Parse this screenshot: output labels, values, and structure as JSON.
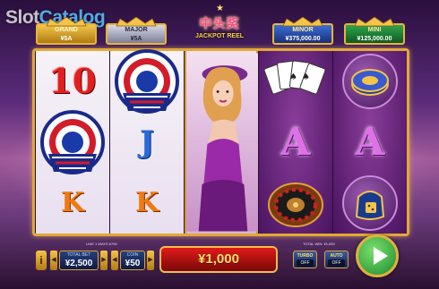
{
  "watermark": {
    "slot": "Slot",
    "catalog": "Catalog"
  },
  "jackpots": {
    "grand": {
      "name": "GRAND",
      "value": "¥5A"
    },
    "major": {
      "name": "MAJOR",
      "value": "¥5A"
    },
    "minor": {
      "name": "MINOR",
      "value": "¥375,000.00"
    },
    "mini": {
      "name": "MINI",
      "value": "¥125,000.00"
    }
  },
  "logo": {
    "cn": "中头奖",
    "en": "JACKPOT REEL"
  },
  "reels": [
    {
      "style": "light",
      "symbols": [
        "10",
        "flag-fan",
        "K"
      ]
    },
    {
      "style": "light",
      "symbols": [
        "flag-fan",
        "J",
        "K"
      ]
    },
    {
      "style": "wild",
      "symbols": [
        "lady-wild",
        "lady-wild",
        "lady-wild"
      ]
    },
    {
      "style": "purple",
      "symbols": [
        "cards",
        "A",
        "roulette"
      ]
    },
    {
      "style": "purple",
      "symbols": [
        "chip",
        "A",
        "dice-bag"
      ]
    }
  ],
  "controls": {
    "lines_label": "LINE 1 WAYS 6790",
    "total_bet_label": "TOTAL BET",
    "total_bet_value": "¥2,500",
    "coin_label": "COIN",
    "coin_value": "¥50",
    "total_win_label": "TOTAL WIN: ¥1,000",
    "win_value": "¥1,000",
    "turbo_label": "TURBO",
    "turbo_state": "OFF",
    "auto_label": "AUTO",
    "auto_state": "OFF",
    "info_label": "i"
  },
  "colors": {
    "frame": "#e2a838",
    "win_bg": "#e01a1a",
    "spin": "#3cb84a"
  }
}
